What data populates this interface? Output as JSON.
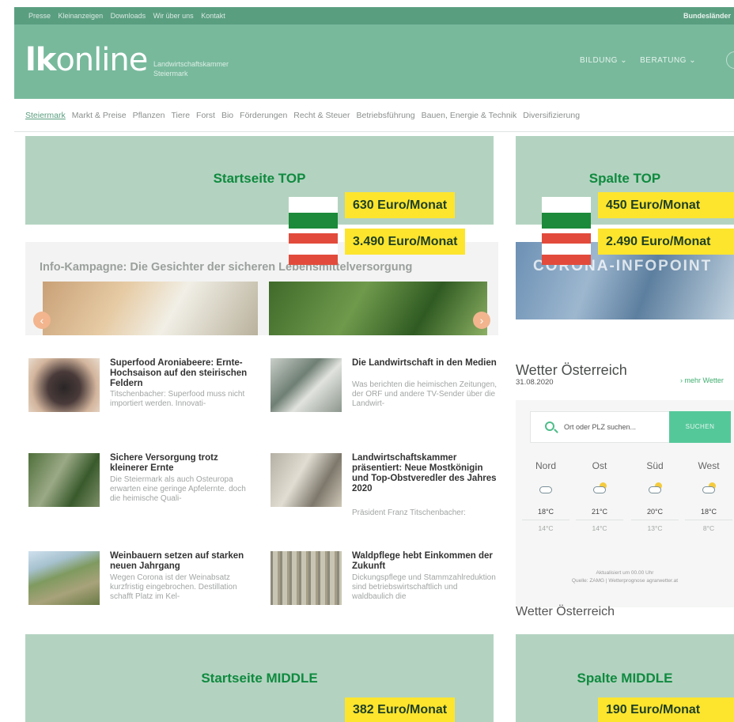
{
  "topbar": {
    "links": [
      "Presse",
      "Kleinanzeigen",
      "Downloads",
      "Wir über uns",
      "Kontakt"
    ],
    "right": "Bundesländer"
  },
  "header": {
    "logo_bold": "lk",
    "logo_rest": "online",
    "logo_sub1": "Landwirtschaftskammer",
    "logo_sub2": "Steiermark",
    "menu": [
      "BILDUNG ⌄",
      "BERATUNG ⌄"
    ]
  },
  "nav": {
    "items": [
      "Steiermark",
      "Markt & Preise",
      "Pflanzen",
      "Tiere",
      "Forst",
      "Bio",
      "Förderungen",
      "Recht & Steuer",
      "Betriebsführung",
      "Bauen, Energie & Technik",
      "Diversifizierung"
    ]
  },
  "ads": {
    "startseite_top": {
      "label": "Startseite TOP",
      "price_st": "630 Euro/Monat",
      "price_at": "3.490 Euro/Monat"
    },
    "spalte_top": {
      "label": "Spalte TOP",
      "price_st": "450 Euro/Monat",
      "price_at": "2.490 Euro/Monat"
    },
    "startseite_middle": {
      "label": "Startseite MIDDLE",
      "price": "382 Euro/Monat"
    },
    "spalte_middle": {
      "label": "Spalte MIDDLE",
      "price": "190 Euro/Monat"
    }
  },
  "campaign": {
    "title": "Info-Kampagne: Die Gesichter der sicheren Lebensmittelversorgung",
    "prev": "‹",
    "next": "›"
  },
  "articles": [
    {
      "title": "Superfood Aroniabeere: Ernte-Hochsaison auf den steirischen Feldern",
      "teaser": "Titschenbacher: Superfood muss nicht importiert werden. Innovati-"
    },
    {
      "title": "Die Landwirtschaft in den Medien",
      "teaser": "Was berichten die heimischen Zeitungen, der ORF und andere TV-Sender über die Landwirt-"
    },
    {
      "title": "Sichere Versorgung trotz kleinerer Ernte",
      "teaser": "Die Steiermark als auch Osteuropa erwarten eine geringe Apfelernte. doch die heimische Quali-"
    },
    {
      "title": "Landwirtschaftskammer präsentiert: Neue Mostkönigin und Top-Obstveredler des Jahres 2020",
      "teaser": "Präsident Franz Titschenbacher:"
    },
    {
      "title": "Weinbauern setzen auf starken neuen Jahrgang",
      "teaser": "Wegen Corona ist der Weinabsatz kurzfristig eingebrochen. Destillation schafft Platz im Kel-"
    },
    {
      "title": "Waldpflege hebt Einkommen der Zukunft",
      "teaser": "Dickungspflege und Stammzahlreduktion sind betriebswirtschaftlich und waldbaulich die"
    }
  ],
  "corona": {
    "text": "CORONA-INFOPOINT"
  },
  "weather": {
    "title": "Wetter Österreich",
    "date": "31.08.2020",
    "more": "› mehr Wetter",
    "search_placeholder": "Ort oder PLZ suchen...",
    "search_button": "SUCHEN",
    "columns": [
      {
        "dir": "Nord",
        "hi": "18°C",
        "lo": "14°C",
        "icon": "cloud-icon"
      },
      {
        "dir": "Ost",
        "hi": "21°C",
        "lo": "14°C",
        "icon": "sun-cloud-icon"
      },
      {
        "dir": "Süd",
        "hi": "20°C",
        "lo": "13°C",
        "icon": "sun-cloud-icon"
      },
      {
        "dir": "West",
        "hi": "18°C",
        "lo": "8°C",
        "icon": "sun-cloud-icon"
      }
    ],
    "updated": "Aktualisiert um 00.00 Uhr",
    "source": "Quelle: ZAMG | Wetterprognose agrarwetter.at",
    "title2": "Wetter Österreich"
  },
  "colors": {
    "brand_green": "#78b99c",
    "ad_bg": "#b3d3c0",
    "ad_text": "#0f8a3f",
    "price_bg": "#fde52e"
  }
}
